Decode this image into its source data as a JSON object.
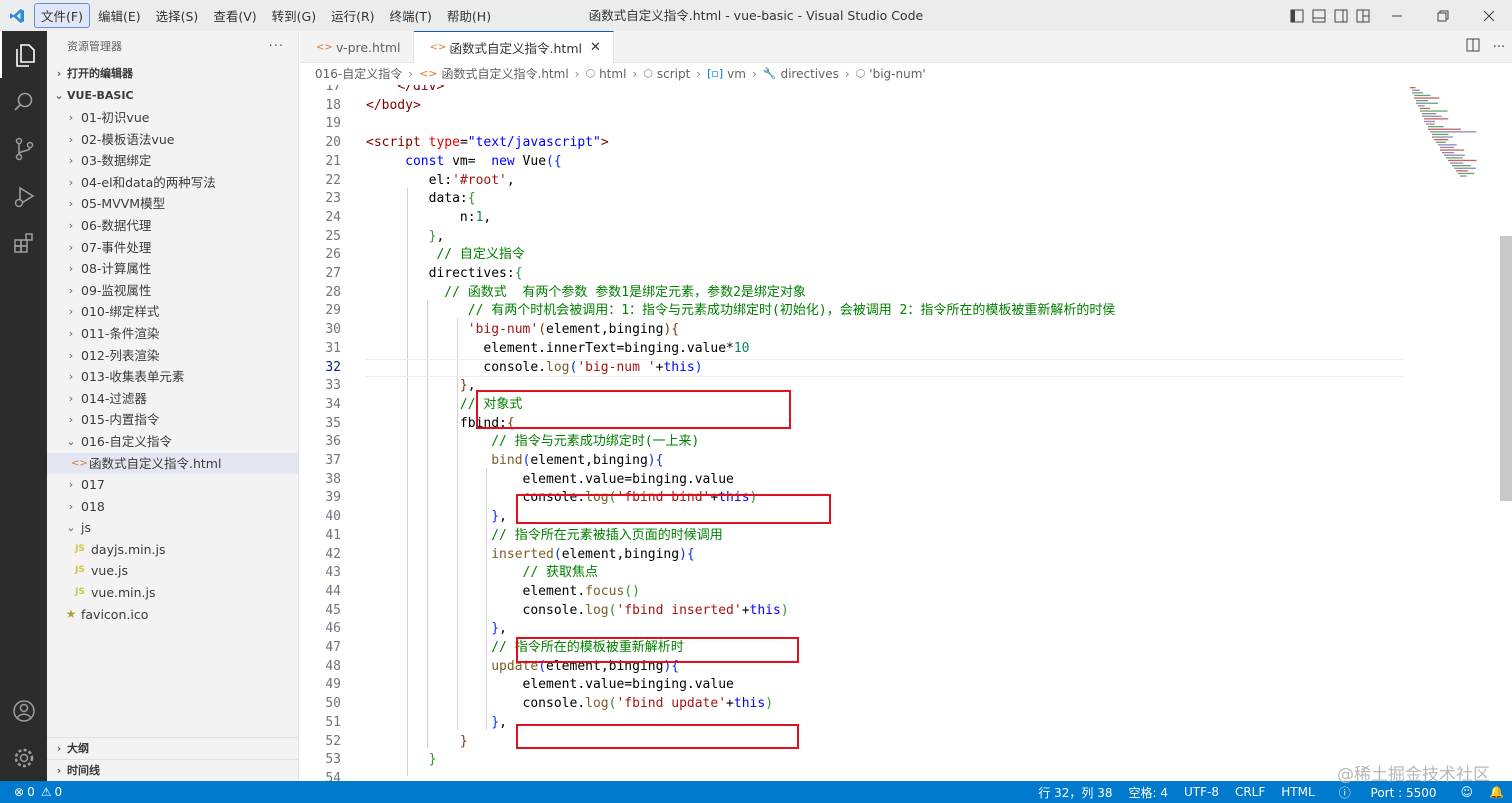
{
  "titlebar": {
    "menu": [
      "文件(F)",
      "编辑(E)",
      "选择(S)",
      "查看(V)",
      "转到(G)",
      "运行(R)",
      "终端(T)",
      "帮助(H)"
    ],
    "title": "函数式自定义指令.html - vue-basic - Visual Studio Code"
  },
  "sidebar": {
    "header": "资源管理器",
    "open_editors": "打开的编辑器",
    "workspace": "VUE-BASIC",
    "items": [
      {
        "label": "01-初识vue",
        "type": "folder"
      },
      {
        "label": "02-模板语法vue",
        "type": "folder"
      },
      {
        "label": "03-数据绑定",
        "type": "folder"
      },
      {
        "label": "04-el和data的两种写法",
        "type": "folder"
      },
      {
        "label": "05-MVVM模型",
        "type": "folder"
      },
      {
        "label": "06-数据代理",
        "type": "folder"
      },
      {
        "label": "07-事件处理",
        "type": "folder"
      },
      {
        "label": "08-计算属性",
        "type": "folder"
      },
      {
        "label": "09-监视属性",
        "type": "folder"
      },
      {
        "label": "010-绑定样式",
        "type": "folder"
      },
      {
        "label": "011-条件渲染",
        "type": "folder"
      },
      {
        "label": "012-列表渲染",
        "type": "folder"
      },
      {
        "label": "013-收集表单元素",
        "type": "folder"
      },
      {
        "label": "014-过滤器",
        "type": "folder"
      },
      {
        "label": "015-内置指令",
        "type": "folder"
      },
      {
        "label": "016-自定义指令",
        "type": "folder-open"
      },
      {
        "label": "函数式自定义指令.html",
        "type": "html",
        "selected": true
      },
      {
        "label": "017",
        "type": "folder"
      },
      {
        "label": "018",
        "type": "folder"
      },
      {
        "label": "js",
        "type": "folder-open"
      },
      {
        "label": "dayjs.min.js",
        "type": "js"
      },
      {
        "label": "vue.js",
        "type": "js"
      },
      {
        "label": "vue.min.js",
        "type": "js"
      },
      {
        "label": "favicon.ico",
        "type": "ico"
      }
    ],
    "outline": "大纲",
    "timeline": "时间线"
  },
  "tabs": [
    {
      "label": "v-pre.html",
      "active": false
    },
    {
      "label": "函数式自定义指令.html",
      "active": true
    }
  ],
  "breadcrumb": [
    "016-自定义指令",
    "函数式自定义指令.html",
    "html",
    "script",
    "vm",
    "directives",
    "'big-num'"
  ],
  "editor": {
    "current_line": 32,
    "lines": [
      {
        "n": "17",
        "h": "    <span class=\"t\">&lt;/div&gt;</span>"
      },
      {
        "n": "18",
        "h": "<span class=\"t\">&lt;/body&gt;</span>"
      },
      {
        "n": "19",
        "h": ""
      },
      {
        "n": "20",
        "h": "<span class=\"t\">&lt;script</span> <span class=\"a\">type</span>=<span class=\"k\">\"text/javascript\"</span><span class=\"t\">&gt;</span>"
      },
      {
        "n": "21",
        "h": "     <span class=\"k\">const</span> vm=  <span class=\"k\">new</span> Vue<span class=\"b1\">({</span>"
      },
      {
        "n": "22",
        "h": "        el:<span class=\"s\">'#root'</span>,"
      },
      {
        "n": "23",
        "h": "        data:<span class=\"b2\">{</span>"
      },
      {
        "n": "24",
        "h": "            n:<span class=\"n\">1</span>,"
      },
      {
        "n": "25",
        "h": "        <span class=\"b2\">}</span>,"
      },
      {
        "n": "26",
        "h": "         <span class=\"c\">// 自定义指令</span>"
      },
      {
        "n": "27",
        "h": "        directives:<span class=\"b2\">{</span>"
      },
      {
        "n": "28",
        "h": "          <span class=\"c\">// 函数式  有两个参数 参数1是绑定元素，参数2是绑定对象</span>"
      },
      {
        "n": "29",
        "h": "             <span class=\"c\">// 有两个时机会被调用：1：指令与元素成功绑定时(初始化)，会被调用 2：指令所在的模板被重新解析的时侯</span>"
      },
      {
        "n": "30",
        "h": "             <span class=\"s\">'big-num'</span><span class=\"b3\">(</span>element,binging<span class=\"b3\">)</span><span class=\"b3\">{</span>"
      },
      {
        "n": "31",
        "h": "               element.innerText=binging.value*<span class=\"n\">10</span>"
      },
      {
        "n": "32",
        "h": "               console.<span class=\"f\">log</span><span class=\"b1\">(</span><span class=\"s\">'big-num '</span>+<span class=\"k\">this</span><span class=\"b1\">)</span>"
      },
      {
        "n": "33",
        "h": "            <span class=\"b3\">}</span>,"
      },
      {
        "n": "34",
        "h": "            <span class=\"c\">// 对象式</span>"
      },
      {
        "n": "35",
        "h": "            fbind:<span class=\"b3\">{</span>"
      },
      {
        "n": "36",
        "h": "                <span class=\"c\">// 指令与元素成功绑定时(一上来)</span>"
      },
      {
        "n": "37",
        "h": "                <span class=\"f\">bind</span><span class=\"b1\">(</span>element,binging<span class=\"b1\">)</span><span class=\"b1\">{</span>"
      },
      {
        "n": "38",
        "h": "                    element.value=binging.value"
      },
      {
        "n": "39",
        "h": "                    console.<span class=\"f\">log</span><span class=\"b2\">(</span><span class=\"s\">'fbind bind'</span>+<span class=\"k\">this</span><span class=\"b2\">)</span>"
      },
      {
        "n": "40",
        "h": "                <span class=\"b1\">}</span>,"
      },
      {
        "n": "41",
        "h": "                <span class=\"c\">// 指令所在元素被插入页面的时候调用</span>"
      },
      {
        "n": "42",
        "h": "                <span class=\"f\">inserted</span><span class=\"b1\">(</span>element,binging<span class=\"b1\">)</span><span class=\"b1\">{</span>"
      },
      {
        "n": "43",
        "h": "                    <span class=\"c\">// 获取焦点</span>"
      },
      {
        "n": "44",
        "h": "                    element.<span class=\"f\">focus</span><span class=\"b2\">()</span>"
      },
      {
        "n": "45",
        "h": "                    console.<span class=\"f\">log</span><span class=\"b2\">(</span><span class=\"s\">'fbind inserted'</span>+<span class=\"k\">this</span><span class=\"b2\">)</span>"
      },
      {
        "n": "46",
        "h": "                <span class=\"b1\">}</span>,"
      },
      {
        "n": "47",
        "h": "                <span class=\"c\">// 指令所在的模板被重新解析时</span>"
      },
      {
        "n": "48",
        "h": "                <span class=\"f\">update</span><span class=\"b1\">(</span>element,binging<span class=\"b1\">)</span><span class=\"b1\">{</span>"
      },
      {
        "n": "49",
        "h": "                    element.value=binging.value"
      },
      {
        "n": "50",
        "h": "                    console.<span class=\"f\">log</span><span class=\"b2\">(</span><span class=\"s\">'fbind update'</span>+<span class=\"k\">this</span><span class=\"b2\">)</span>"
      },
      {
        "n": "51",
        "h": "                <span class=\"b1\">}</span>,"
      },
      {
        "n": "52",
        "h": "            <span class=\"b3\">}</span>"
      },
      {
        "n": "53",
        "h": "        <span class=\"b2\">}</span>"
      },
      {
        "n": "54",
        "h": ""
      }
    ]
  },
  "statusbar": {
    "errors": "0",
    "warnings": "0",
    "position": "行 32，列 38",
    "spaces": "空格: 4",
    "encoding": "UTF-8",
    "eol": "CRLF",
    "language": "HTML",
    "port": "Port : 5500"
  },
  "watermark": "@稀土掘金技术社区"
}
